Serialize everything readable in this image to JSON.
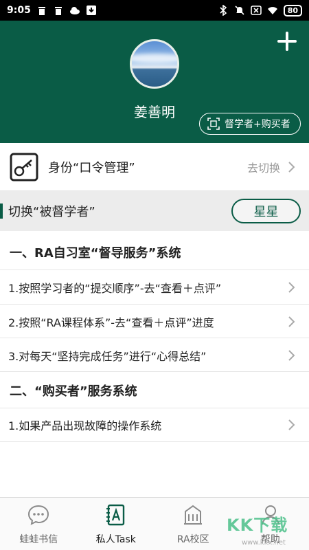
{
  "status_bar": {
    "time": "9:05",
    "battery": "80",
    "left_icons": [
      "trash-icon",
      "trash-icon",
      "cloud-icon",
      "download-icon"
    ],
    "right_icons": [
      "bluetooth-icon",
      "mute-icon",
      "sim-off-icon",
      "wifi-icon"
    ]
  },
  "header": {
    "user_name": "姜善明",
    "role_button": "督学者+购买者",
    "bg_color": "#0a5c46"
  },
  "identity": {
    "label": "身份“口令管理”",
    "action": "去切换"
  },
  "switch": {
    "label": "切换“被督学者”",
    "button": "星星"
  },
  "sections": [
    {
      "title": "一、RA自习室“督导服务”系统",
      "items": [
        "1.按照学习者的“提交顺序”-去“查看＋点评”",
        "2.按照“RA课程体系”-去“查看＋点评”进度",
        "3.对每天“坚持完成任务”进行“心得总结”"
      ]
    },
    {
      "title": "二、“购买者”服务系统",
      "items": [
        "1.如果产品出现故障的操作系统"
      ]
    }
  ],
  "bottom_nav": [
    {
      "label": "蛙蛙书信",
      "icon": "chat-bubble-icon",
      "active": false
    },
    {
      "label": "私人Task",
      "icon": "task-book-icon",
      "active": true
    },
    {
      "label": "RA校区",
      "icon": "building-icon",
      "active": false
    },
    {
      "label": "帮助",
      "icon": "help-icon",
      "active": false
    }
  ],
  "watermark": {
    "text": "KK下载",
    "url": "www.kkx.net"
  }
}
